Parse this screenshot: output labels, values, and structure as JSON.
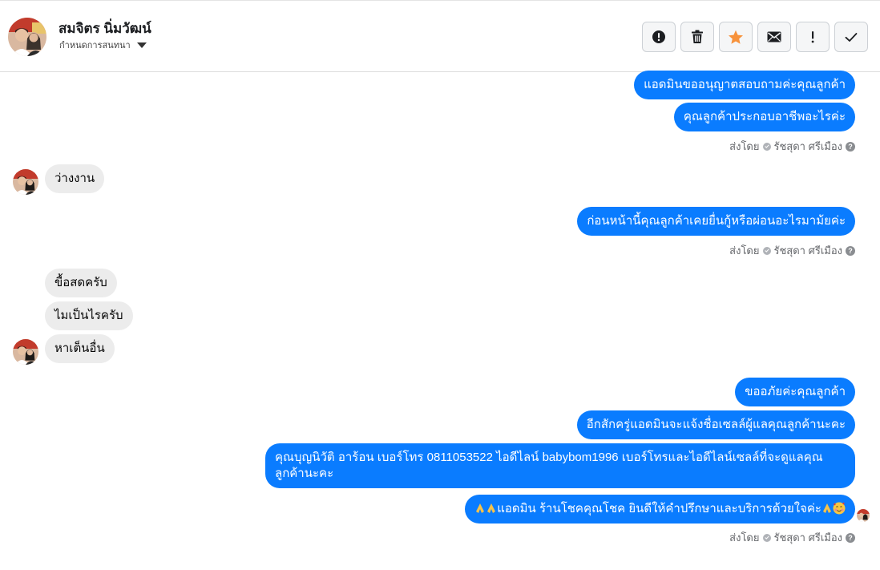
{
  "header": {
    "contact_name": "สมจิตร นิ่มวัฒน์",
    "assign_label": "กำหนดการสนทนา",
    "avatar_icon": "contact-photo-avatar"
  },
  "toolbar": {
    "buttons": [
      {
        "icon": "alert-circle-icon"
      },
      {
        "icon": "trash-icon"
      },
      {
        "icon": "star-icon",
        "color": "#f7923b"
      },
      {
        "icon": "envelope-icon"
      },
      {
        "icon": "exclamation-icon"
      },
      {
        "icon": "checkmark-icon"
      }
    ]
  },
  "messages": {
    "out1": "แอดมินขออนุญาตสอบถามค่ะคุณลูกค้า",
    "out2": "คุณลูกค้าประกอบอาชีพอะไรค่ะ",
    "in1": "ว่างงาน",
    "out3": "ก่อนหน้านี้คุณลูกค้าเคยยื่นกู้หรือผ่อนอะไรมาม้ยค่ะ",
    "in2": "ขื้อสดครับ",
    "in3": "ไมเป็นไรครับ",
    "in4": "หาเต็นอื่น",
    "out4": "ขออภัยค่ะคุณลูกค้า",
    "out5": "อีกสักครู่แอดมินจะแจ้งชื่อเซลล์ผู้แลคุณลูกค้านะคะ",
    "out6": "คุณบุญนิวัติ  อาร้อน        เบอร์โทร 0811053522  ไอดีไลน์ babybom1996   เบอร์โทรและไอดีไลน์เซลล์ที่จะดูแลคุณลูกค้านะคะ",
    "out7": "แอดมิน ร้านโชคคุณโชค ยินดีให้คำปรึกษาและบริการด้วยใจค่ะ"
  },
  "sent_by": {
    "prefix": "ส่งโดย",
    "agent": "รัชสุดา ศรีเมือง"
  },
  "colors": {
    "outgoing_bubble": "#0a7cff",
    "incoming_bubble": "#ececec",
    "star": "#f7923b"
  }
}
